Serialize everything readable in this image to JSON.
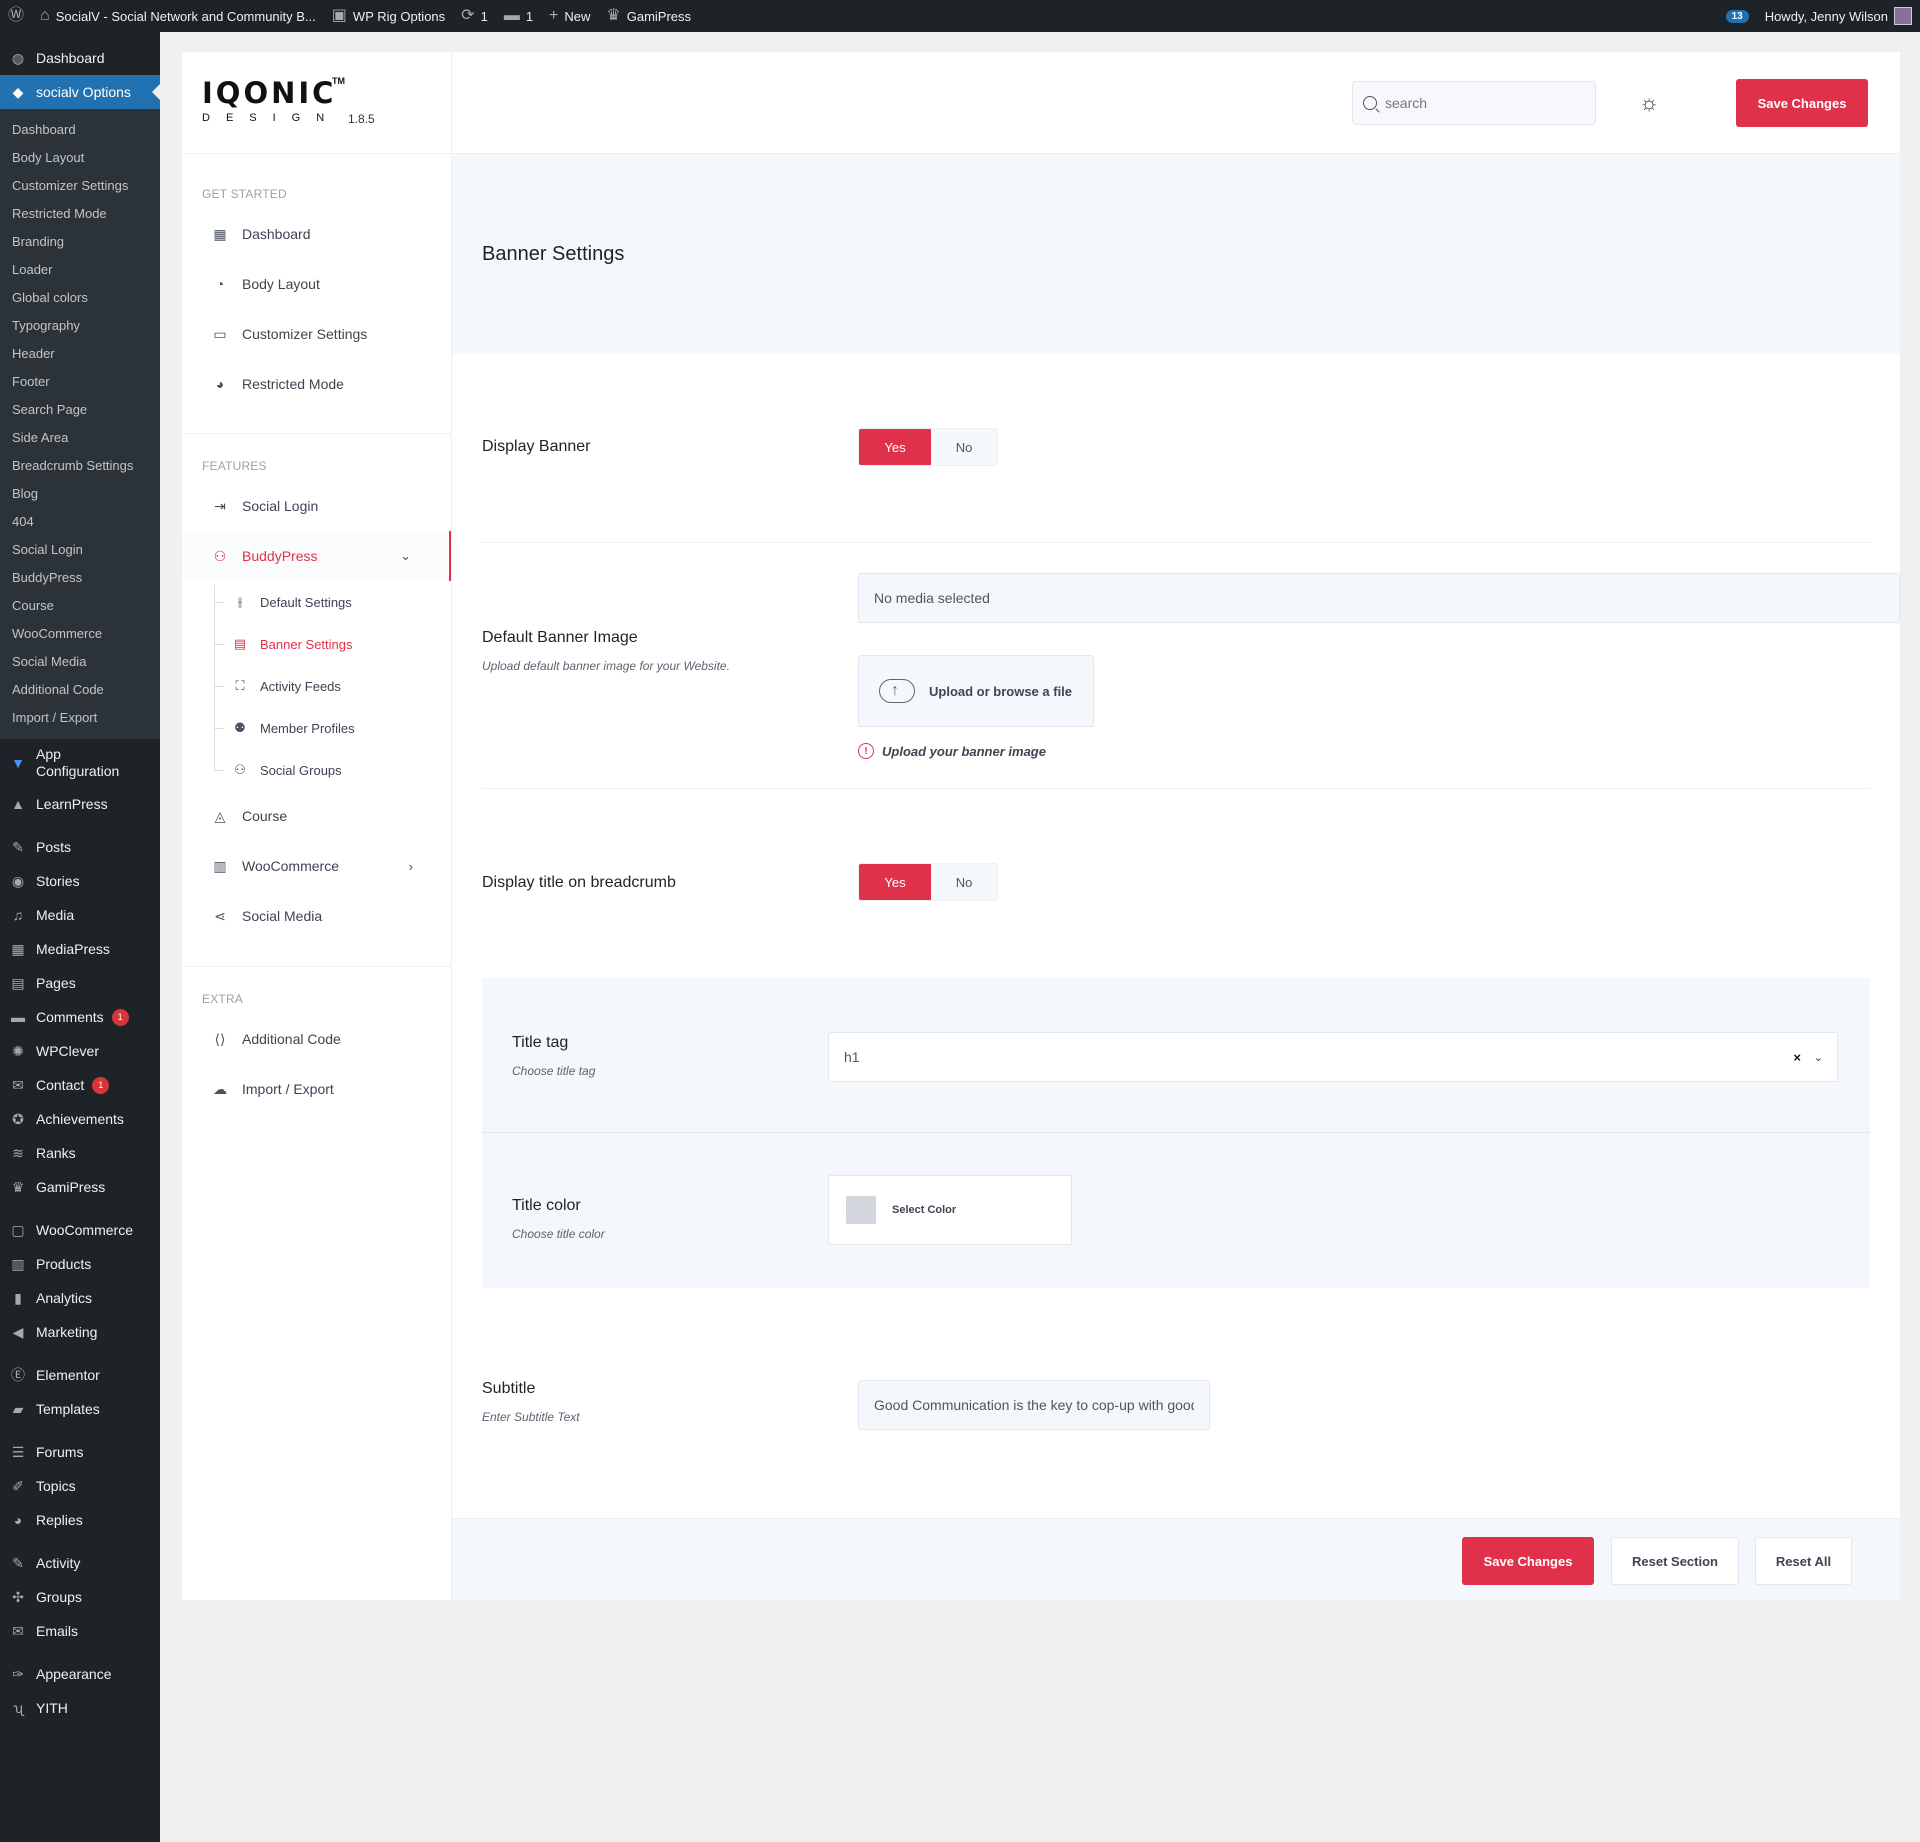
{
  "adminbar": {
    "site_title": "SocialV - Social Network and Community B...",
    "rig_options": "WP Rig Options",
    "updates_count": "1",
    "comments_count": "1",
    "new_label": "New",
    "gamipress_label": "GamiPress",
    "notif_count": "13",
    "howdy": "Howdy, Jenny Wilson"
  },
  "adminmenu": {
    "dashboard": "Dashboard",
    "current": "socialv Options",
    "sub_items": [
      "Dashboard",
      "Body Layout",
      "Customizer Settings",
      "Restricted Mode",
      "Branding",
      "Loader",
      "Global colors",
      "Typography",
      "Header",
      "Footer",
      "Search Page",
      "Side Area",
      "Breadcrumb Settings",
      "Blog",
      "404",
      "Social Login",
      "BuddyPress",
      "Course",
      "WooCommerce",
      "Social Media",
      "Additional Code",
      "Import / Export"
    ],
    "app_config_line1": "App",
    "app_config_line2": "Configuration",
    "learnpress": "LearnPress",
    "group2": [
      "Posts",
      "Stories",
      "Media",
      "MediaPress",
      "Pages"
    ],
    "comments": "Comments",
    "comments_count": "1",
    "wpclever": "WPClever",
    "contact": "Contact",
    "contact_count": "1",
    "group3": [
      "Achievements",
      "Ranks",
      "GamiPress"
    ],
    "group4": [
      "WooCommerce",
      "Products",
      "Analytics",
      "Marketing"
    ],
    "group5": [
      "Elementor",
      "Templates"
    ],
    "group6": [
      "Forums",
      "Topics",
      "Replies"
    ],
    "group7": [
      "Activity",
      "Groups",
      "Emails"
    ],
    "group8": [
      "Appearance",
      "YITH"
    ]
  },
  "logo": {
    "word": "IQONIC",
    "tm": "TM",
    "sub": "DESIGN",
    "version": "1.8.5"
  },
  "options_nav": {
    "get_started": "GET STARTED",
    "gs_items": [
      "Dashboard",
      "Body Layout",
      "Customizer Settings",
      "Restricted Mode"
    ],
    "features": "FEATURES",
    "social_login": "Social Login",
    "buddypress": "BuddyPress",
    "bp_sub": [
      "Default Settings",
      "Banner Settings",
      "Activity Feeds",
      "Member Profiles",
      "Social Groups"
    ],
    "course": "Course",
    "woocommerce": "WooCommerce",
    "social_media": "Social Media",
    "extra": "EXTRA",
    "additional_code": "Additional Code",
    "import_export": "Import / Export"
  },
  "topbar": {
    "search_placeholder": "search",
    "save_label": "Save Changes"
  },
  "page": {
    "title": "Banner Settings"
  },
  "fields": {
    "display_banner": {
      "label": "Display Banner",
      "yes": "Yes",
      "no": "No",
      "value": "Yes"
    },
    "default_image": {
      "label": "Default Banner Image",
      "desc": "Upload default banner image for your Website.",
      "media_text": "No media selected",
      "upload_label": "Upload or browse a file",
      "hint": "Upload your banner image"
    },
    "breadcrumb_title": {
      "label": "Display title on breadcrumb",
      "yes": "Yes",
      "no": "No",
      "value": "Yes"
    },
    "title_tag": {
      "label": "Title tag",
      "desc": "Choose title tag",
      "value": "h1"
    },
    "title_color": {
      "label": "Title color",
      "desc": "Choose title color",
      "button": "Select Color",
      "swatch": "#d3d6dd"
    },
    "subtitle": {
      "label": "Subtitle",
      "desc": "Enter Subtitle Text",
      "value": "Good Communication is the key to cop-up with good ideas"
    }
  },
  "footer": {
    "save": "Save Changes",
    "reset_section": "Reset Section",
    "reset_all": "Reset All"
  },
  "colors": {
    "accent": "#e0314b",
    "wp_blue": "#2271b1",
    "wp_dark": "#1d2327"
  }
}
